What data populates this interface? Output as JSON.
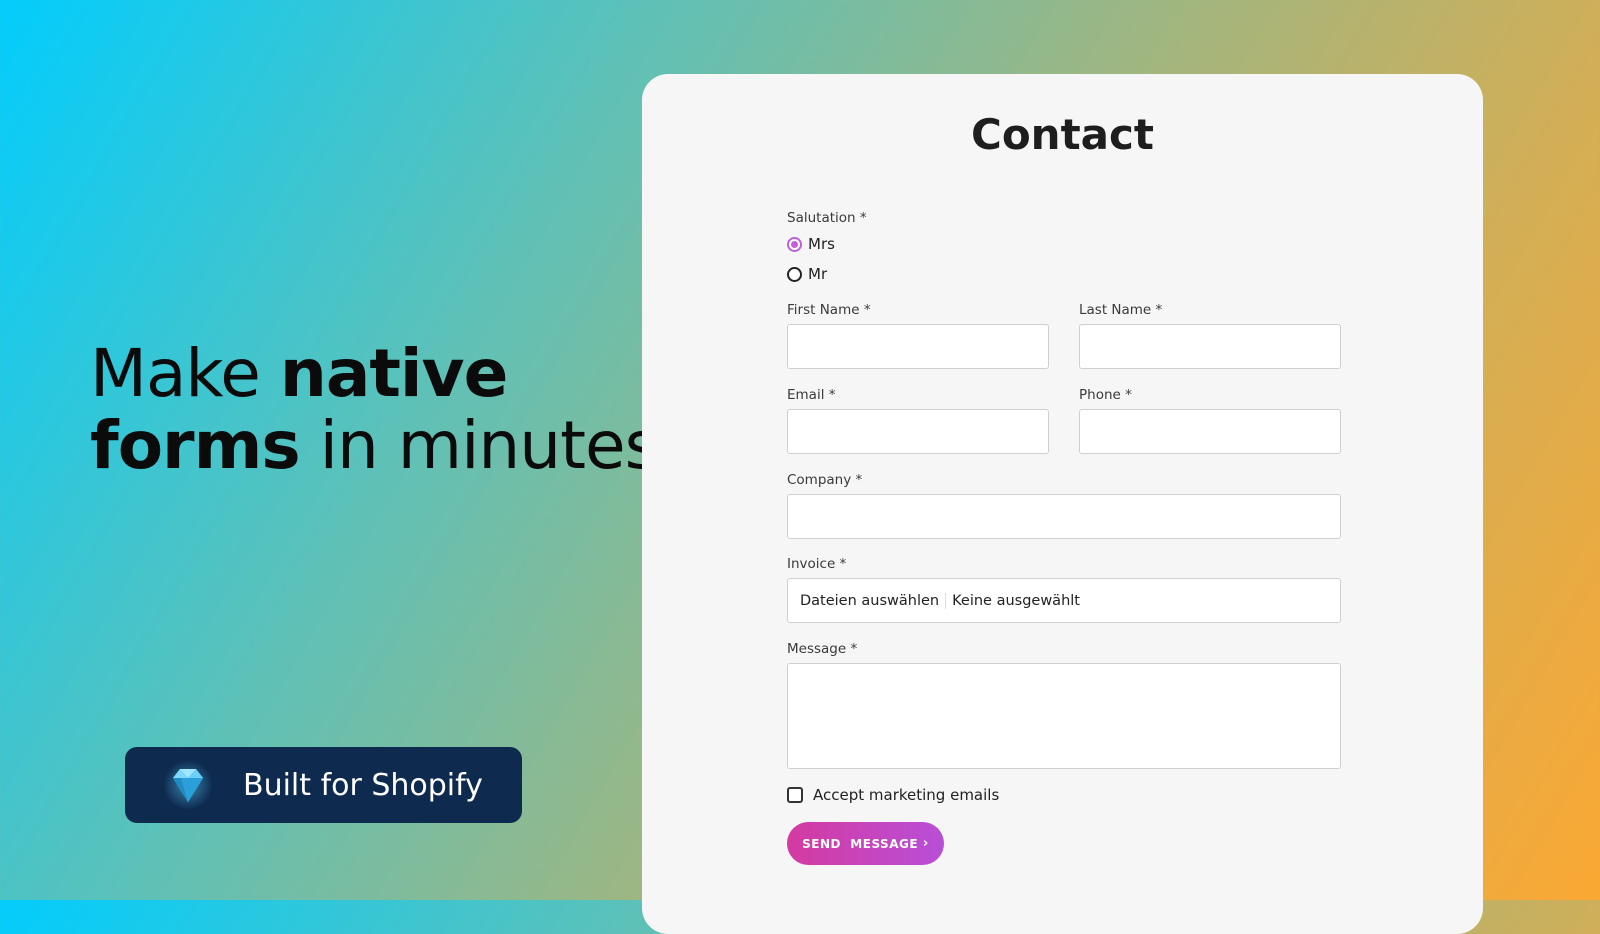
{
  "hero": {
    "line1_light": "Make ",
    "line1_bold": "native",
    "line2_bold": "forms",
    "line2_light": " in minutes."
  },
  "badge": {
    "icon": "diamond-icon",
    "text": "Built for Shopify"
  },
  "form": {
    "title": "Contact",
    "salutation_label": "Salutation *",
    "salutation_options": [
      {
        "label": "Mrs",
        "checked": true
      },
      {
        "label": "Mr",
        "checked": false
      }
    ],
    "first_name_label": "First Name *",
    "last_name_label": "Last Name *",
    "email_label": "Email *",
    "phone_label": "Phone *",
    "company_label": "Company *",
    "invoice_label": "Invoice *",
    "invoice_button": "Dateien auswählen",
    "invoice_status": "Keine ausgewählt",
    "message_label": "Message *",
    "marketing_label": "Accept marketing emails",
    "marketing_checked": false,
    "submit_label": "SEND  MESSAGE",
    "submit_icon": "chevron-right-icon"
  },
  "colors": {
    "accent": "#c060d8",
    "button_start": "#d43aa0",
    "button_end": "#b84fd8",
    "badge_bg": "#0e2a4f"
  }
}
